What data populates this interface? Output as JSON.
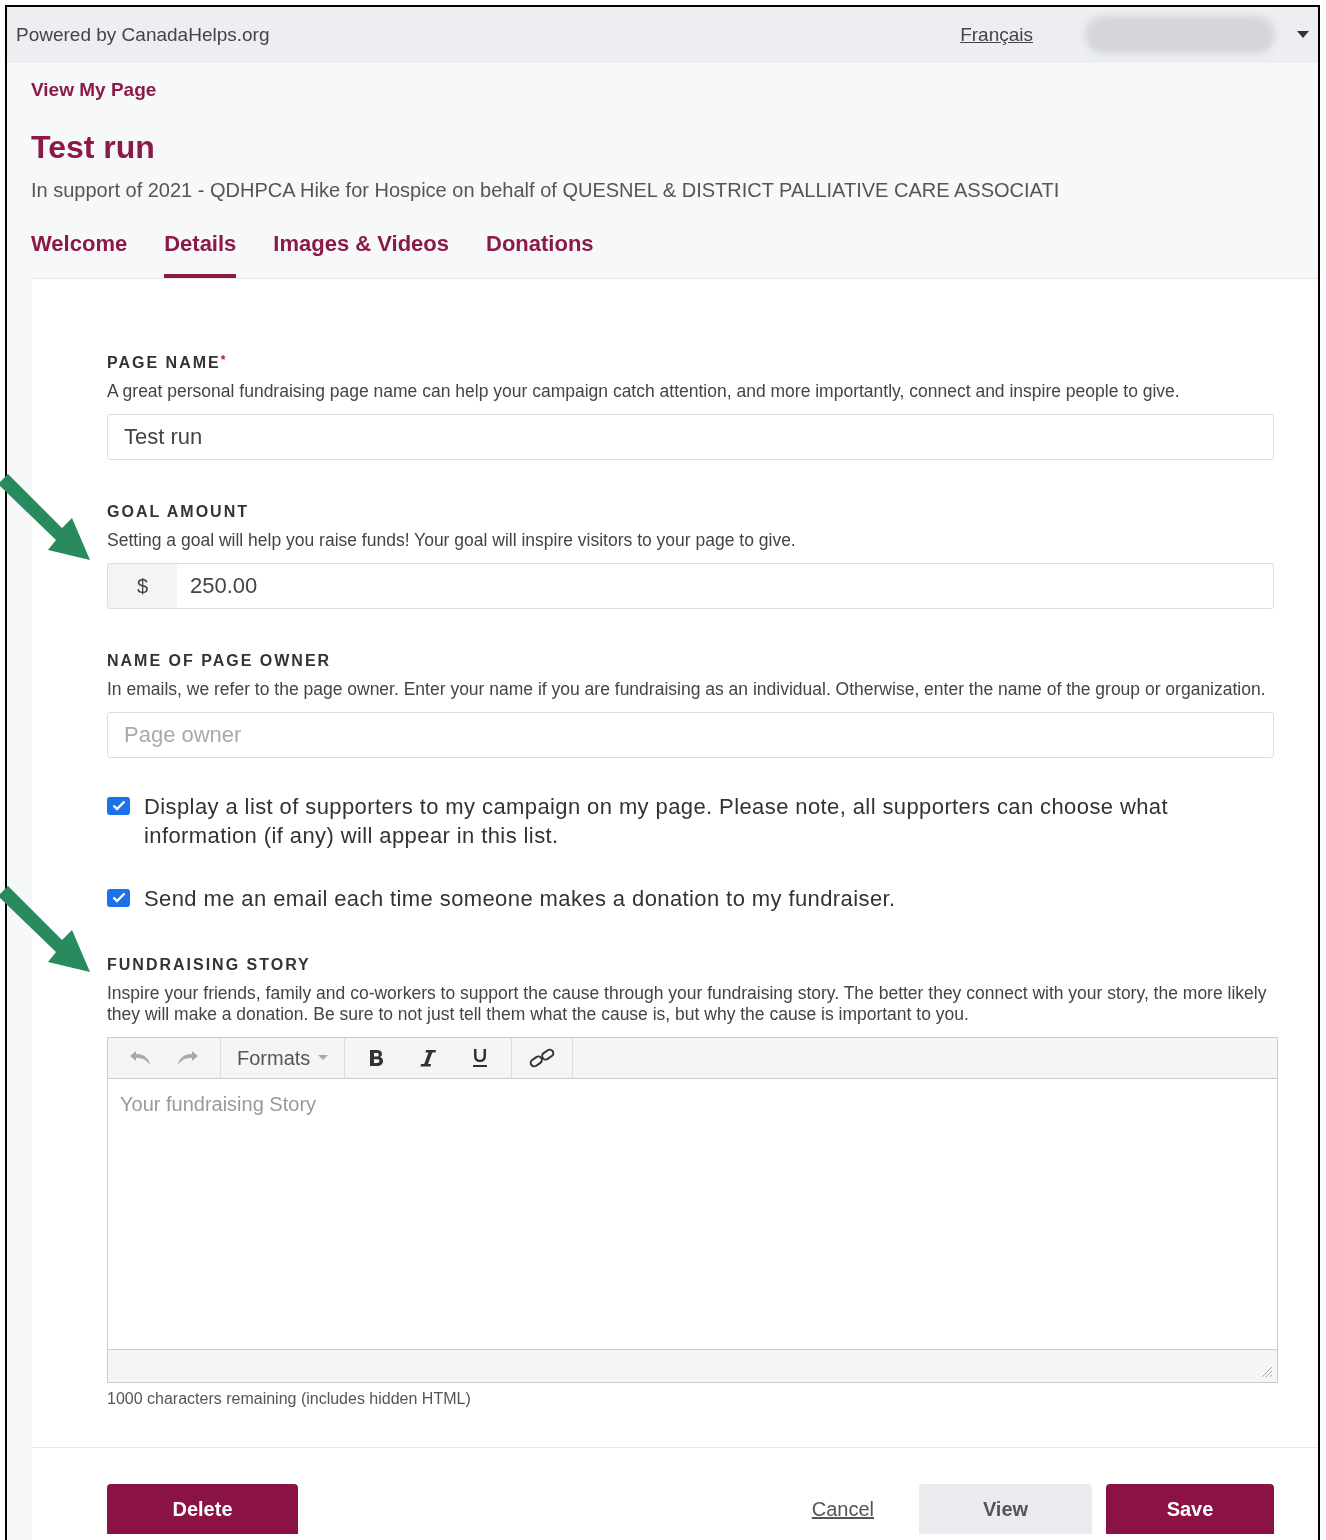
{
  "top_bar": {
    "powered_by": "Powered by CanadaHelps.org",
    "language_link": "Français"
  },
  "header": {
    "view_link": "View My Page",
    "title": "Test run",
    "subtitle": "In support of 2021 - QDHPCA Hike for Hospice on behalf of QUESNEL & DISTRICT PALLIATIVE CARE ASSOCIATI"
  },
  "tabs": [
    {
      "label": "Welcome",
      "selected": false
    },
    {
      "label": "Details",
      "selected": true
    },
    {
      "label": "Images & Videos",
      "selected": false
    },
    {
      "label": "Donations",
      "selected": false
    }
  ],
  "fields": [
    {
      "kind": "text",
      "label": "PAGE NAME",
      "required_mark": "*",
      "help": "A great personal fundraising page name can help your campaign catch attention, and more importantly, connect and inspire people to give.",
      "value": "Test run"
    },
    {
      "kind": "currency",
      "label": "GOAL AMOUNT",
      "help": "Setting a goal will help you raise funds! Your goal will inspire visitors to your page to give.",
      "prefix": "$",
      "value": "250.00"
    },
    {
      "kind": "text",
      "label": "NAME OF PAGE OWNER",
      "help": "In emails, we refer to the page owner. Enter your name if you are fundraising as an individual. Otherwise, enter the name of the group or organization.",
      "placeholder": "Page owner"
    }
  ],
  "checkboxes": [
    {
      "label": "Display a list of supporters to my campaign on my page. Please note, all supporters can choose what information (if any) will appear in this list.",
      "checked": true
    },
    {
      "label": "Send me an email each time someone makes a donation to my fundraiser.",
      "checked": true
    }
  ],
  "story": {
    "label": "FUNDRAISING STORY",
    "help": "Inspire your friends, family and co-workers to support the cause through your fundraising story. The better they connect with your story, the more likely they will make a donation. Be sure to not just tell them what the cause is, but why the cause is important to you.",
    "formats": "Formats",
    "placeholder": "Your fundraising Story",
    "counter": "1000 characters remaining (includes hidden HTML)"
  },
  "buttons": [
    {
      "label": "Delete",
      "kind": "danger"
    },
    {
      "label": "Cancel",
      "kind": "link"
    },
    {
      "label": "View",
      "kind": "secondary"
    },
    {
      "label": "Save",
      "kind": "primary"
    }
  ]
}
